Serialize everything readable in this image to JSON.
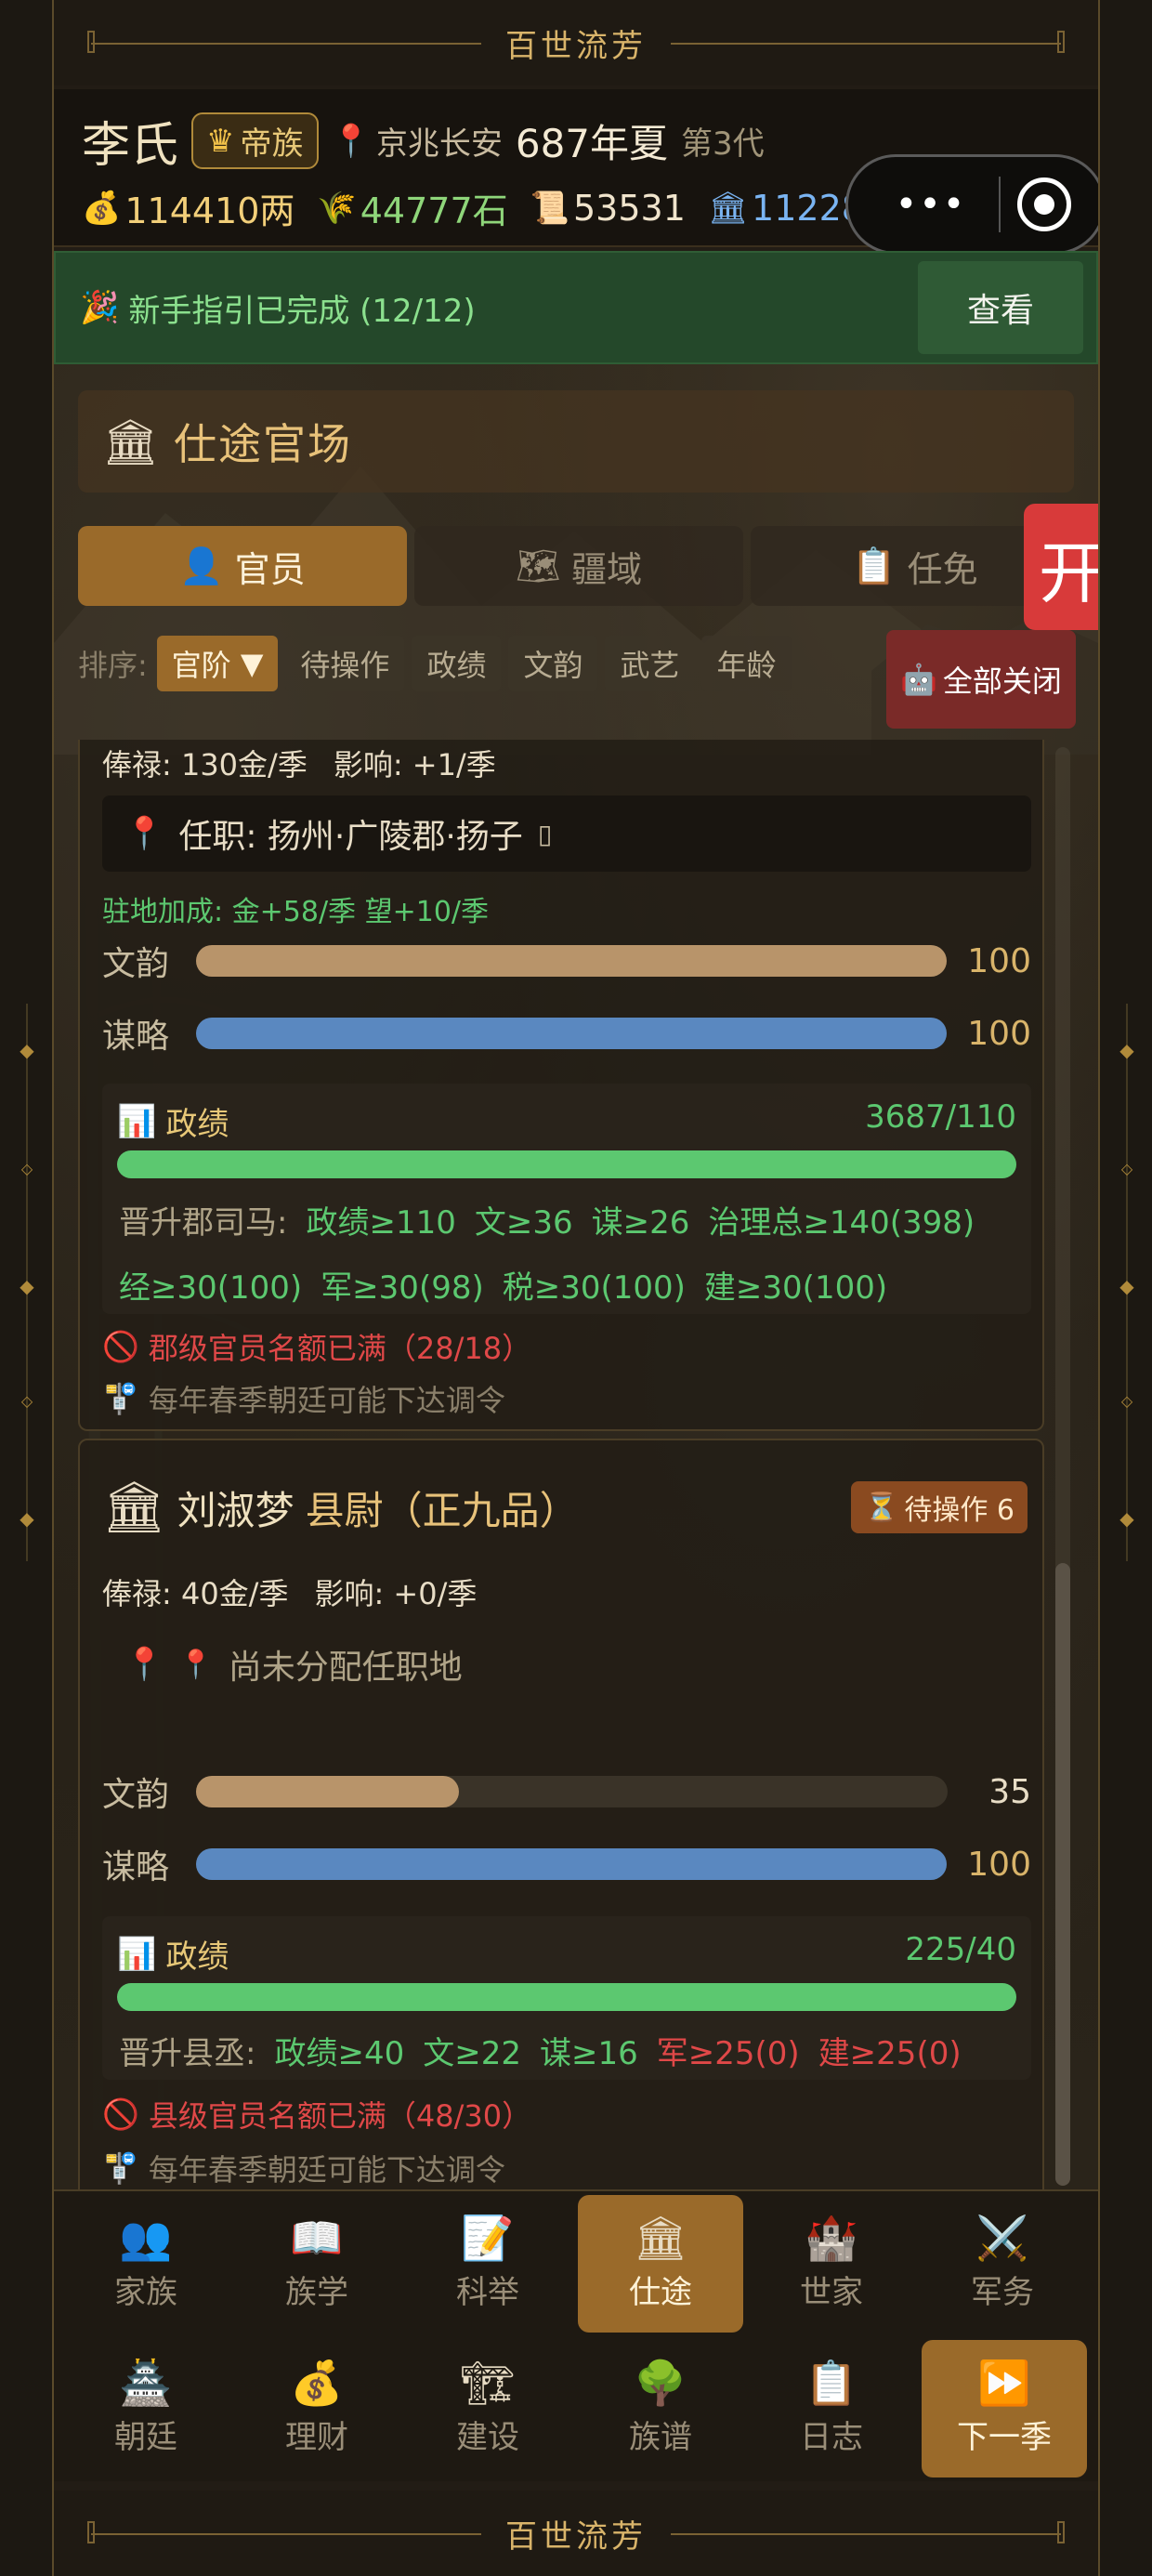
{
  "banner": {
    "title": "百世流芳"
  },
  "header": {
    "family": "李氏",
    "rank_badge": "帝族",
    "location": "京兆长安",
    "date": "687年夏",
    "generation": "第3代",
    "resources": {
      "gold": "114410两",
      "grain": "44777石",
      "paper": "53531",
      "prestige": "11228"
    }
  },
  "guide": {
    "text": "新手指引已完成 (12/12)",
    "button": "查看"
  },
  "section": {
    "title": "仕途官场"
  },
  "tabs": [
    {
      "label": "官员",
      "icon": "person-icon"
    },
    {
      "label": "疆域",
      "icon": "map-icon"
    },
    {
      "label": "任免",
      "icon": "clipboard-icon"
    }
  ],
  "edge_tab": {
    "label": "开"
  },
  "sort": {
    "label": "排序:",
    "options": [
      "官阶",
      "待操作",
      "政绩",
      "文韵",
      "武艺",
      "年龄"
    ],
    "active_suffix": "▼",
    "close_all": "全部关闭"
  },
  "cards": [
    {
      "salary": "俸禄: 130金/季",
      "influence": "影响: +1/季",
      "post": "任职: 扬州·广陵郡·扬子",
      "bonus": "驻地加成: 金+58/季  望+10/季",
      "stats": [
        {
          "name": "文韵",
          "value": "100",
          "fraction": 1.0
        },
        {
          "name": "谋略",
          "value": "100",
          "fraction": 1.0
        }
      ],
      "performance": {
        "label": "政绩",
        "value": "3687/110",
        "promotion_label": "晋升郡司马:",
        "line1": [
          {
            "text": "政绩≥110",
            "ok": true
          },
          {
            "text": "文≥36",
            "ok": true
          },
          {
            "text": "谋≥26",
            "ok": true
          },
          {
            "text": "治理总≥140(398)",
            "ok": true
          }
        ],
        "line2": [
          {
            "text": "经≥30(100)",
            "ok": true
          },
          {
            "text": "军≥30(98)",
            "ok": true
          },
          {
            "text": "税≥30(100)",
            "ok": true
          },
          {
            "text": "建≥30(100)",
            "ok": true
          }
        ]
      },
      "warning": "郡级官员名额已满（28/18）",
      "note": "每年春季朝廷可能下达调令"
    },
    {
      "name": "刘淑梦",
      "position": "县尉（正九品）",
      "pending": "待操作 6",
      "salary": "俸禄: 40金/季",
      "influence": "影响: +0/季",
      "post": "尚未分配任职地",
      "stats": [
        {
          "name": "文韵",
          "value": "35",
          "fraction": 0.35
        },
        {
          "name": "谋略",
          "value": "100",
          "fraction": 1.0
        }
      ],
      "performance": {
        "label": "政绩",
        "value": "225/40",
        "promotion_label": "晋升县丞:",
        "line1": [
          {
            "text": "政绩≥40",
            "ok": true
          },
          {
            "text": "文≥22",
            "ok": true
          },
          {
            "text": "谋≥16",
            "ok": true
          },
          {
            "text": "军≥25(0)",
            "ok": false
          },
          {
            "text": "建≥25(0)",
            "ok": false
          }
        ]
      },
      "warning": "县级官员名额已满（48/30）",
      "note": "每年春季朝廷可能下达调令"
    }
  ],
  "nav": {
    "row1": [
      {
        "label": "家族",
        "icon": "family-icon"
      },
      {
        "label": "族学",
        "icon": "book-icon"
      },
      {
        "label": "科举",
        "icon": "exam-icon"
      },
      {
        "label": "仕途",
        "icon": "government-icon",
        "active": true
      },
      {
        "label": "世家",
        "icon": "castle-icon"
      },
      {
        "label": "军务",
        "icon": "swords-icon"
      }
    ],
    "row2": [
      {
        "label": "朝廷",
        "icon": "court-icon"
      },
      {
        "label": "理财",
        "icon": "moneybag-icon"
      },
      {
        "label": "建设",
        "icon": "crane-icon"
      },
      {
        "label": "族谱",
        "icon": "tree-icon"
      },
      {
        "label": "日志",
        "icon": "log-icon"
      },
      {
        "label": "下一季",
        "icon": "fast-forward-icon",
        "active": true
      }
    ]
  }
}
